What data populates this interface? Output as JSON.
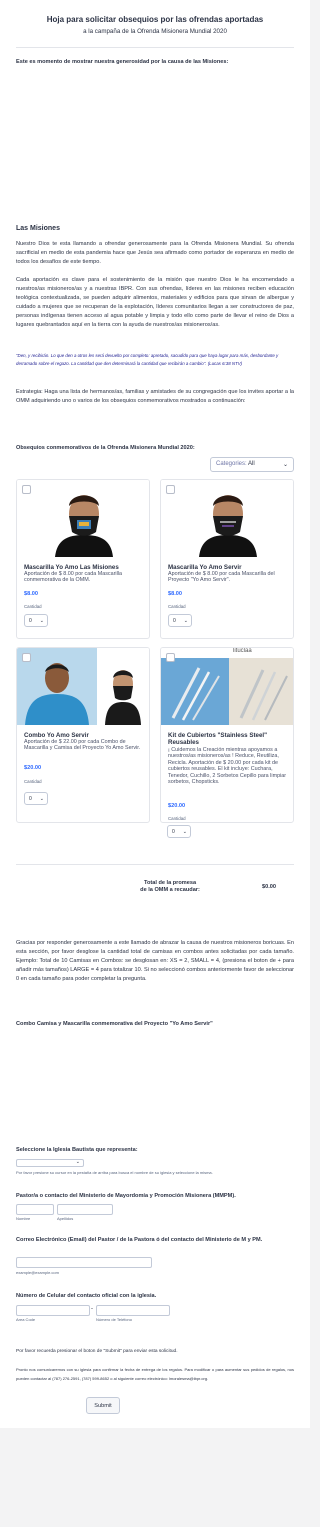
{
  "header": {
    "title": "Hoja para solicitar obsequios por las ofrendas aportadas",
    "subtitle": "a la campaña de la Ofrenda Misionera Mundial 2020"
  },
  "intro_heading": "Este es momento de mostrar nuestra generosidad por la causa de las Misiones:",
  "missions": {
    "title": "Las Misiones",
    "p1": "Nuestro Dios te esta llamando a ofrendar generosamente para la Ofrenda Misionera Mundial. Su ofrenda sacrificial en medio de esta pandemia hace que Jesús sea afirmado como portador de esperanza en medio de todos los desafíos de este tiempo.",
    "p2": "Cada aportación es clave para el sostenimiento de la misión que nuestro Dios le ha encomendado a nuestros/as misioneros/as y a nuestras IBPR. Con sus ofrendas, líderes en las misiones reciben educación teológica contextualizada, se pueden adquirir alimentos, materiales y edificios para que sirvan de albergue y cuidado a mujeres que se recuperan de la explotación, líderes comunitarios llegan a ser constructores de paz, personas indígenas tienen acceso al agua potable y limpia y todo ello como parte de llevar el reino de Dios a lugares quebrantados aquí en la tierra con la ayuda de nuestros/as misioneros/as.",
    "quote": "\"Den, y recibirán. Lo que den a otros les será devuelto por completo: apretado, sacudido para que haya lugar para más, desbordante y derramado sobre el regazo. La cantidad que den determinará la cantidad que recibirán a cambio\". (Lucas 6:38 NTV)",
    "p3": "Estrategia: Haga una lista de hermanos/as, familias y amistades de su congregación que los invites aportar a la OMM adquiriendo uno o varios de los obsequios conmemorativos mostrados a continuación:"
  },
  "products_section": {
    "title": "Obsequios conmemorativos de la Ofrenda Misionera Mundial 2020:",
    "filter_label": "Categories:",
    "filter_value": "All",
    "quantity_label": "Cantidad",
    "items": [
      {
        "name": "Mascarilla Yo Amo Las Misiones",
        "desc": "Aportación de $ 8.00 por cada Mascarilla conmemorativa de la OMM.",
        "price": "$8.00",
        "qty": "0"
      },
      {
        "name": "Mascarilla Yo Amo Servir",
        "desc": "Aportación de $ 8.00 por cada Mascarilla del Proyecto \"Yo Amo Servir\".",
        "price": "$8.00",
        "qty": "0"
      },
      {
        "name": "Combo Yo Amo Servir",
        "desc": "Aportación de $ 22.00 por cada Combo de Mascarilla y Camisa del Proyecto Yo Amo Servir.",
        "price": "$20.00",
        "qty": "0"
      },
      {
        "name": "Kit de Cubiertos \"Stainless Steel\" Reusables",
        "desc": "¡ Cuidemos la Creación mientras apoyamos a nuestros/as misioneros/as ! Reduce, Reutiliza, Recicla.  Aportación de $ 20.00 por cada kit de cubiertos reusables.  El kit incluye: Cuchara, Tenedor, Cuchillo, 2 Sorbetos Cepillo para limpiar sorbetos, Chopsticks.",
        "price": "$20.00",
        "qty": "0",
        "image_text": "lituclaa"
      }
    ],
    "total_label_1": "Total de la promesa",
    "total_label_2": "de la OMM a recaudar:",
    "total_value": "$0.00"
  },
  "sizes_paragraph": "Gracias por responder generosamente a este llamado de abrazar la causa de nuestros misioneros boricuas.  En esta sección, por favor desglose la cantidad total de camisas en combos antes solicitadas por cada tamaño. Ejemplo: Total de 10 Camisas en Combos: se desglosan en: XS = 2, SMALL = 4,  (presiona el boton de + para añadir más tamaños) LARGE = 4 para totalizar 10.  Si no seleccionó combos anteriormente favor de seleccionar 0 en cada tamaño para poder completar la pregunta.",
  "combo_heading": "Combo Camisa y Mascarilla conmemorativa del Proyecto \"Yo Amo Servir\"",
  "church": {
    "label": "Seleccione la Iglesia Bautista que representa:",
    "hint": "Por favor presione su cursor en la pestaña de arriba para busca el nombre de su iglesia y seleccione la misma."
  },
  "pastor": {
    "label": "Pastor/a o contacto del Ministerio de Mayordomía y Promoción Misionera (MMPM).",
    "first_hint": "Nombre",
    "last_hint": "Apellidos"
  },
  "email": {
    "label": "Correo Electrónico (Email) del Pastor / de la Pastora ó del contacto del Ministerio de M y PM.",
    "hint": "example@example.com"
  },
  "phone": {
    "label": "Número de Celular del contacto oficial con la iglesia.",
    "dash": "-",
    "area_hint": "Area Code",
    "number_hint": "Número de Teléfono"
  },
  "footer": {
    "reminder": "Por favor recuerda presionar el boton de \"Submit\" para enviar esta solicitud.",
    "notice": "Pronto nos comunicaremos con su iglesia para confirmar la fecha de entrega de los regalos. Para modificar o para aumentar sus pedidos de regalos, nos pueden contactar al (787) 276-2591, (787) 599-8652 o al siguiente correo electrónico: lmoralesma@ibpr.org.",
    "submit_label": "Submit"
  }
}
